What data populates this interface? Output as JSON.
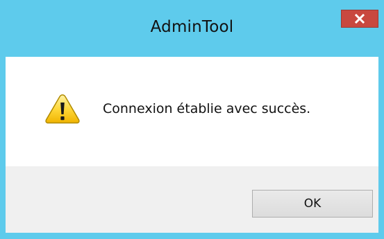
{
  "window": {
    "title": "AdminTool",
    "close_icon": "close-icon",
    "accent_color": "#5ecbec",
    "close_color": "#c9483f"
  },
  "dialog": {
    "icon": "warning-icon",
    "message": "Connexion établie avec succès.",
    "ok_label": "OK"
  }
}
